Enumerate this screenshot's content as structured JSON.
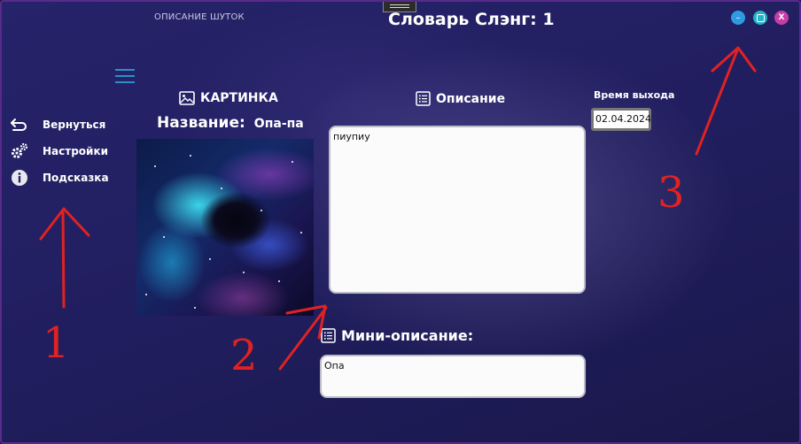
{
  "window": {
    "app_label": "ОПИСАНИЕ ШУТОК",
    "title": "Словарь Слэнг: 1",
    "buttons": {
      "minimize": "–",
      "close": "X"
    }
  },
  "sidebar": {
    "items": [
      {
        "label": "Вернуться",
        "icon": "back-arrow-icon"
      },
      {
        "label": "Настройки",
        "icon": "gears-icon"
      },
      {
        "label": "Подсказка",
        "icon": "info-icon"
      }
    ]
  },
  "picture_section": {
    "heading": "КАРТИНКА",
    "name_label": "Название:",
    "name_value": "Опа-па",
    "image": "galaxy-nebula-image"
  },
  "description_section": {
    "heading": "Описание",
    "text": "пиупиу"
  },
  "release": {
    "label": "Время выхода",
    "date": "02.04.2024"
  },
  "mini_description": {
    "heading": "Мини-описание:",
    "text": "Опа"
  },
  "annotations": {
    "numbers": [
      "1",
      "2",
      "3"
    ],
    "color": "#e02222"
  },
  "colors": {
    "accent_blue": "#2e9be0",
    "close_pink": "#c63da6",
    "hamburger": "#2e8fc8"
  }
}
